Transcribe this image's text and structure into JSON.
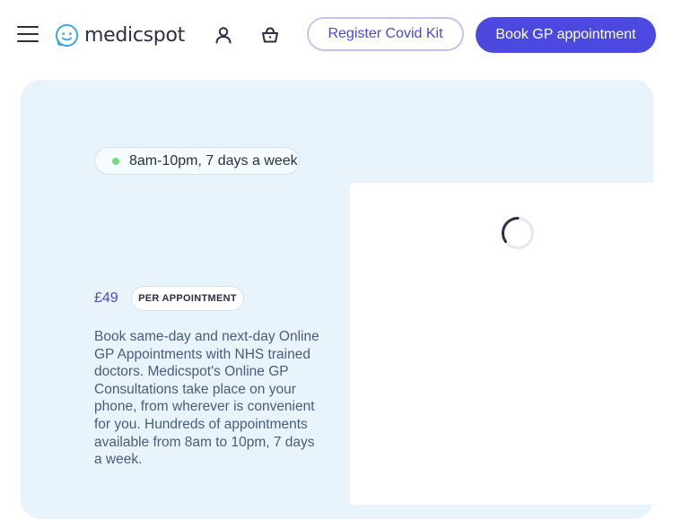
{
  "header": {
    "brand": "medicspot",
    "register_label": "Register Covid Kit",
    "book_label": "Book GP appointment",
    "icons": [
      "menu-icon",
      "logo-icon",
      "account-icon",
      "basket-icon"
    ]
  },
  "hero": {
    "hours": "8am-10pm, 7 days a week",
    "price": "£49",
    "price_unit": "PER APPOINTMENT",
    "description": "Book same-day and next-day Online GP Appointments with NHS trained doctors. Medicspot's Online GP Consultations take place on your phone, from wherever is convenient for you. Hundreds of appointments available from 8am to 10pm, 7 days a week."
  },
  "colors": {
    "accent": "#4b49e0",
    "hero_background": "#e8f3fc",
    "status_dot": "#6fdc7e",
    "text_dark": "#2a2f45"
  }
}
